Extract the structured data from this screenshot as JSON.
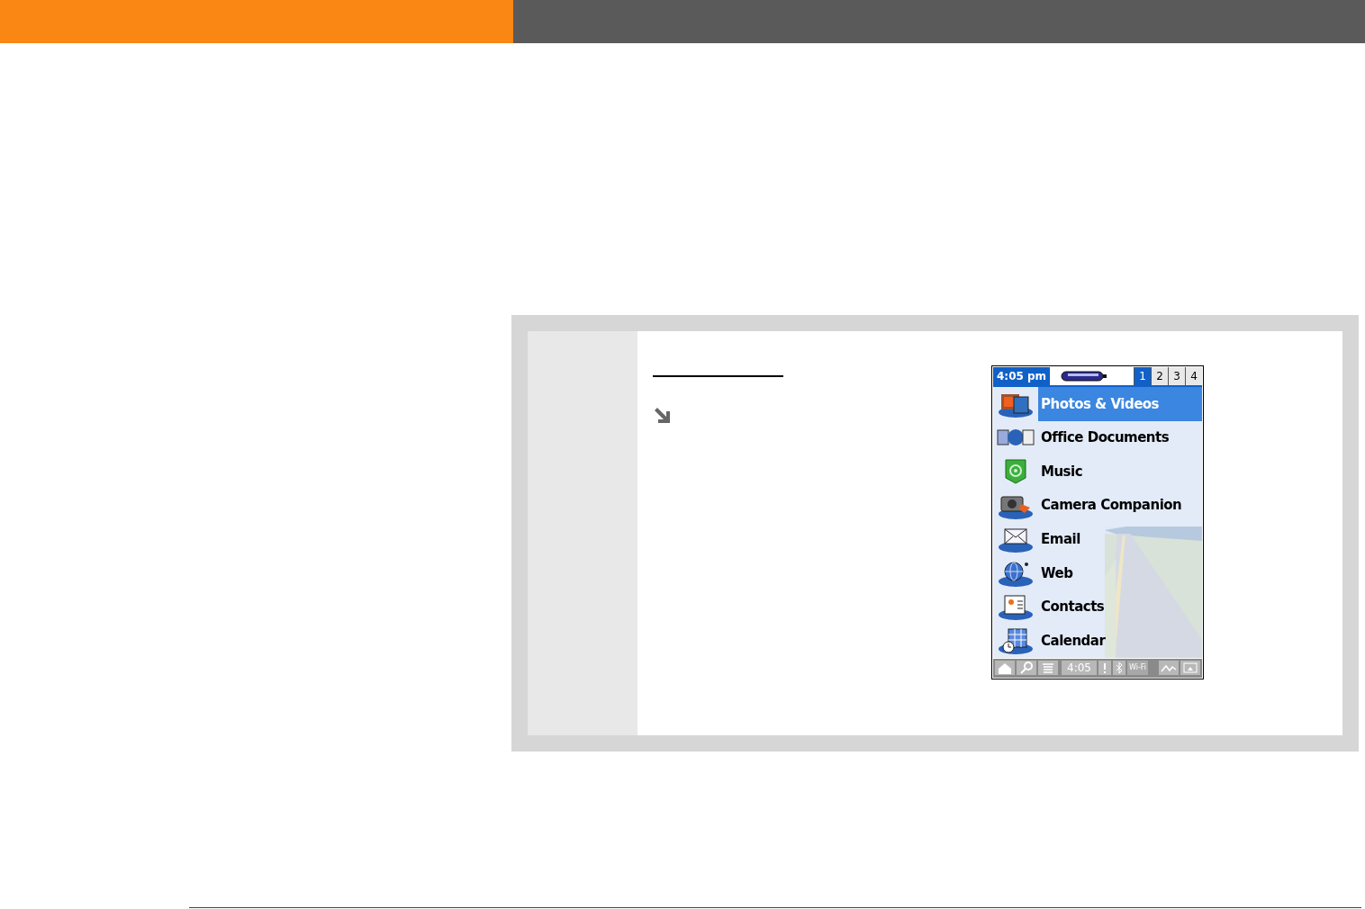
{
  "device": {
    "status_bar": {
      "time": "4:05 pm",
      "categories": [
        {
          "label": "1",
          "selected": true
        },
        {
          "label": "2",
          "selected": false
        },
        {
          "label": "3",
          "selected": false
        },
        {
          "label": "4",
          "selected": false
        }
      ]
    },
    "apps": [
      {
        "name": "Photos & Videos",
        "selected": true
      },
      {
        "name": "Office Documents",
        "selected": false
      },
      {
        "name": "Music",
        "selected": false
      },
      {
        "name": "Camera Companion",
        "selected": false
      },
      {
        "name": "Email",
        "selected": false
      },
      {
        "name": "Web",
        "selected": false
      },
      {
        "name": "Contacts",
        "selected": false
      },
      {
        "name": "Calendar",
        "selected": false
      }
    ],
    "bottom_bar": {
      "time": "4:05",
      "wifi": "Wi-Fi"
    }
  }
}
